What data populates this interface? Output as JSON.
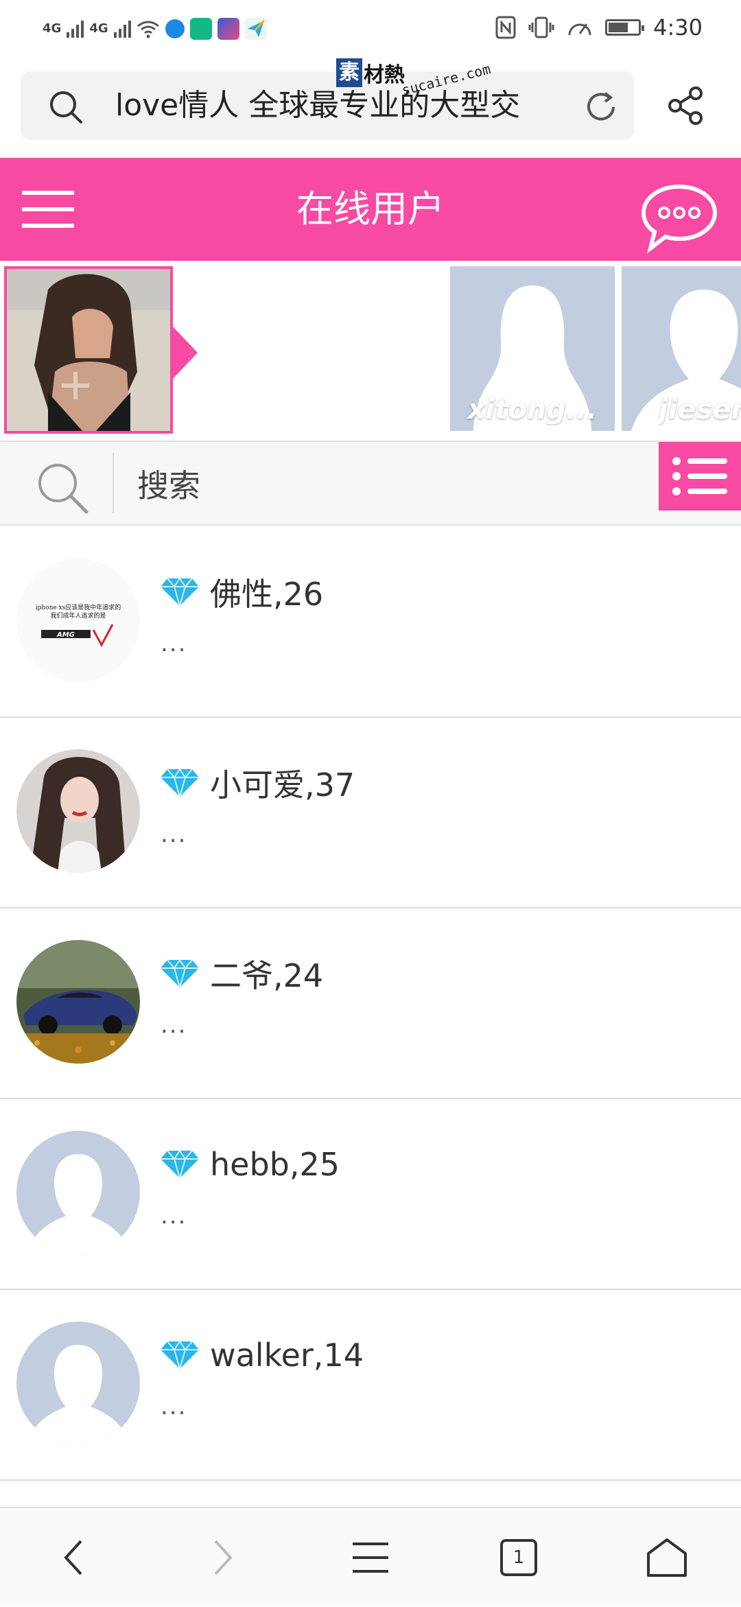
{
  "status_bar": {
    "signal_1": "4G",
    "signal_2": "4G",
    "time": "4:30"
  },
  "browser": {
    "url_text": "love情人 全球最专业的大型交",
    "tab_count": "1"
  },
  "watermark": {
    "cn_box": "素",
    "cn": "材熱",
    "en": "sucaire.com"
  },
  "header": {
    "title": "在线用户"
  },
  "online_users": [
    {
      "caption": "xitong..."
    },
    {
      "caption": "jiesen..."
    }
  ],
  "search": {
    "placeholder": "搜索"
  },
  "users": [
    {
      "name": "佛性,26",
      "bio": "...",
      "avatar": "amg-text"
    },
    {
      "name": "小可爱,37",
      "bio": "...",
      "avatar": "photo-girl"
    },
    {
      "name": "二爷,24",
      "bio": "...",
      "avatar": "photo-car"
    },
    {
      "name": "hebb,25",
      "bio": "...",
      "avatar": "placeholder-male"
    },
    {
      "name": "walker,14",
      "bio": "...",
      "avatar": "placeholder-male"
    }
  ],
  "avatar_texts": {
    "amg_line1": "iphone xs应该是我中年追求的",
    "amg_line2": "我们成年人追求的是",
    "amg_logo": "AMG"
  },
  "colors": {
    "accent": "#f74aa3",
    "diamond": "#29b6e8",
    "placeholder": "#c3cde0"
  }
}
